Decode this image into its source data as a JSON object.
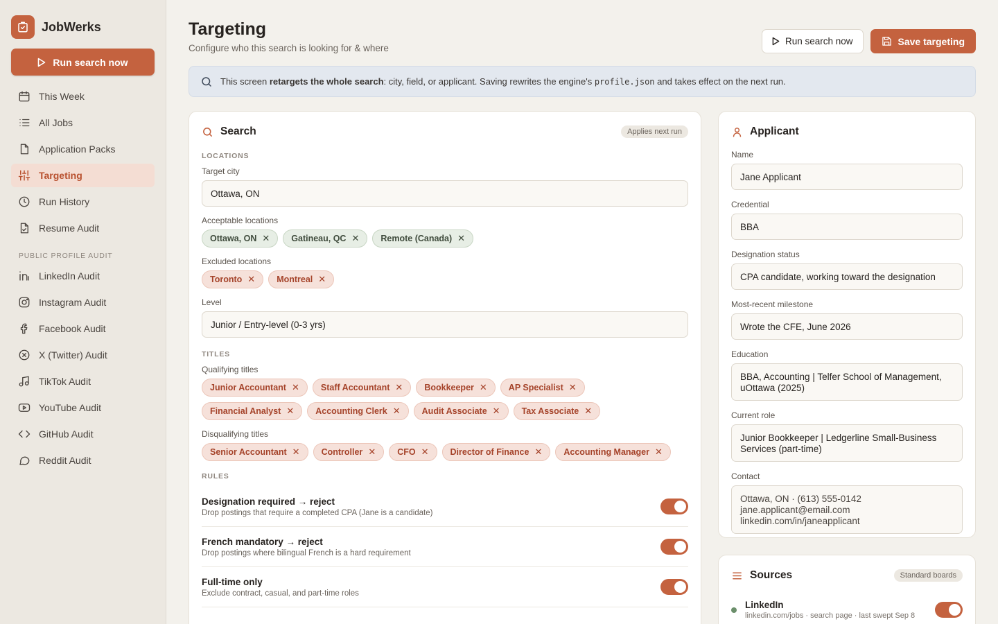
{
  "brand": {
    "name": "JobWerks"
  },
  "sidebar": {
    "run_label": "Run search now",
    "items": [
      {
        "label": "This Week",
        "icon": "calendar-icon"
      },
      {
        "label": "All Jobs",
        "icon": "list-icon"
      },
      {
        "label": "Application Packs",
        "icon": "file-icon"
      },
      {
        "label": "Targeting",
        "icon": "sliders-icon",
        "active": true
      },
      {
        "label": "Run History",
        "icon": "clock-icon"
      },
      {
        "label": "Resume Audit",
        "icon": "file-check-icon"
      }
    ],
    "section_label": "PUBLIC PROFILE AUDIT",
    "audit_items": [
      {
        "label": "LinkedIn Audit",
        "icon": "linkedin-icon"
      },
      {
        "label": "Instagram Audit",
        "icon": "instagram-icon"
      },
      {
        "label": "Facebook Audit",
        "icon": "facebook-icon"
      },
      {
        "label": "X (Twitter) Audit",
        "icon": "x-icon"
      },
      {
        "label": "TikTok Audit",
        "icon": "music-icon"
      },
      {
        "label": "YouTube Audit",
        "icon": "youtube-icon"
      },
      {
        "label": "GitHub Audit",
        "icon": "code-icon"
      },
      {
        "label": "Reddit Audit",
        "icon": "chat-icon"
      }
    ]
  },
  "header": {
    "title": "Targeting",
    "subtitle": "Configure who this search is looking for & where",
    "run_label": "Run search now",
    "save_label": "Save targeting"
  },
  "banner": {
    "pre": "This screen ",
    "bold": "retargets the whole search",
    "mid": ": city, field, or applicant. Saving rewrites the engine's ",
    "code": "profile.json",
    "post": " and takes effect on the next run."
  },
  "search": {
    "title": "Search",
    "badge": "Applies next run",
    "locations_label": "LOCATIONS",
    "target_city_label": "Target city",
    "target_city": "Ottawa, ON",
    "acceptable_label": "Acceptable locations",
    "acceptable": [
      "Ottawa, ON",
      "Gatineau, QC",
      "Remote (Canada)"
    ],
    "excluded_label": "Excluded locations",
    "excluded": [
      "Toronto",
      "Montreal"
    ],
    "level_label": "Level",
    "level": "Junior / Entry-level (0-3 yrs)",
    "titles_label": "TITLES",
    "qualifying_label": "Qualifying titles",
    "qualifying": [
      "Junior Accountant",
      "Staff Accountant",
      "Bookkeeper",
      "AP Specialist",
      "Financial Analyst",
      "Accounting Clerk",
      "Audit Associate",
      "Tax Associate"
    ],
    "disqualifying_label": "Disqualifying titles",
    "disqualifying": [
      "Senior Accountant",
      "Controller",
      "CFO",
      "Director of Finance",
      "Accounting Manager"
    ],
    "rules_label": "RULES",
    "rules": [
      {
        "title": "Designation required → reject",
        "desc": "Drop postings that require a completed CPA (Jane is a candidate)"
      },
      {
        "title": "French mandatory → reject",
        "desc": "Drop postings where bilingual French is a hard requirement"
      },
      {
        "title": "Full-time only",
        "desc": "Exclude contract, casual, and part-time roles"
      }
    ]
  },
  "applicant": {
    "title": "Applicant",
    "name_label": "Name",
    "name": "Jane Applicant",
    "credential_label": "Credential",
    "credential": "BBA",
    "designation_label": "Designation status",
    "designation": "CPA candidate, working toward the designation",
    "milestone_label": "Most-recent milestone",
    "milestone": "Wrote the CFE, June 2026",
    "education_label": "Education",
    "education": "BBA, Accounting | Telfer School of Management, uOttawa (2025)",
    "role_label": "Current role",
    "role": "Junior Bookkeeper | Ledgerline Small-Business Services (part-time)",
    "contact_label": "Contact",
    "contact_line1": "Ottawa, ON  ·  (613) 555-0142",
    "contact_line2": "jane.applicant@email.com",
    "contact_line3": "linkedin.com/in/janeapplicant"
  },
  "sources": {
    "title": "Sources",
    "badge": "Standard boards",
    "items": [
      {
        "name": "LinkedIn",
        "meta": "linkedin.com/jobs · search page · last swept Sep 8"
      }
    ]
  },
  "colors": {
    "accent": "#c4623f",
    "active_bg": "#f4ddd3"
  }
}
